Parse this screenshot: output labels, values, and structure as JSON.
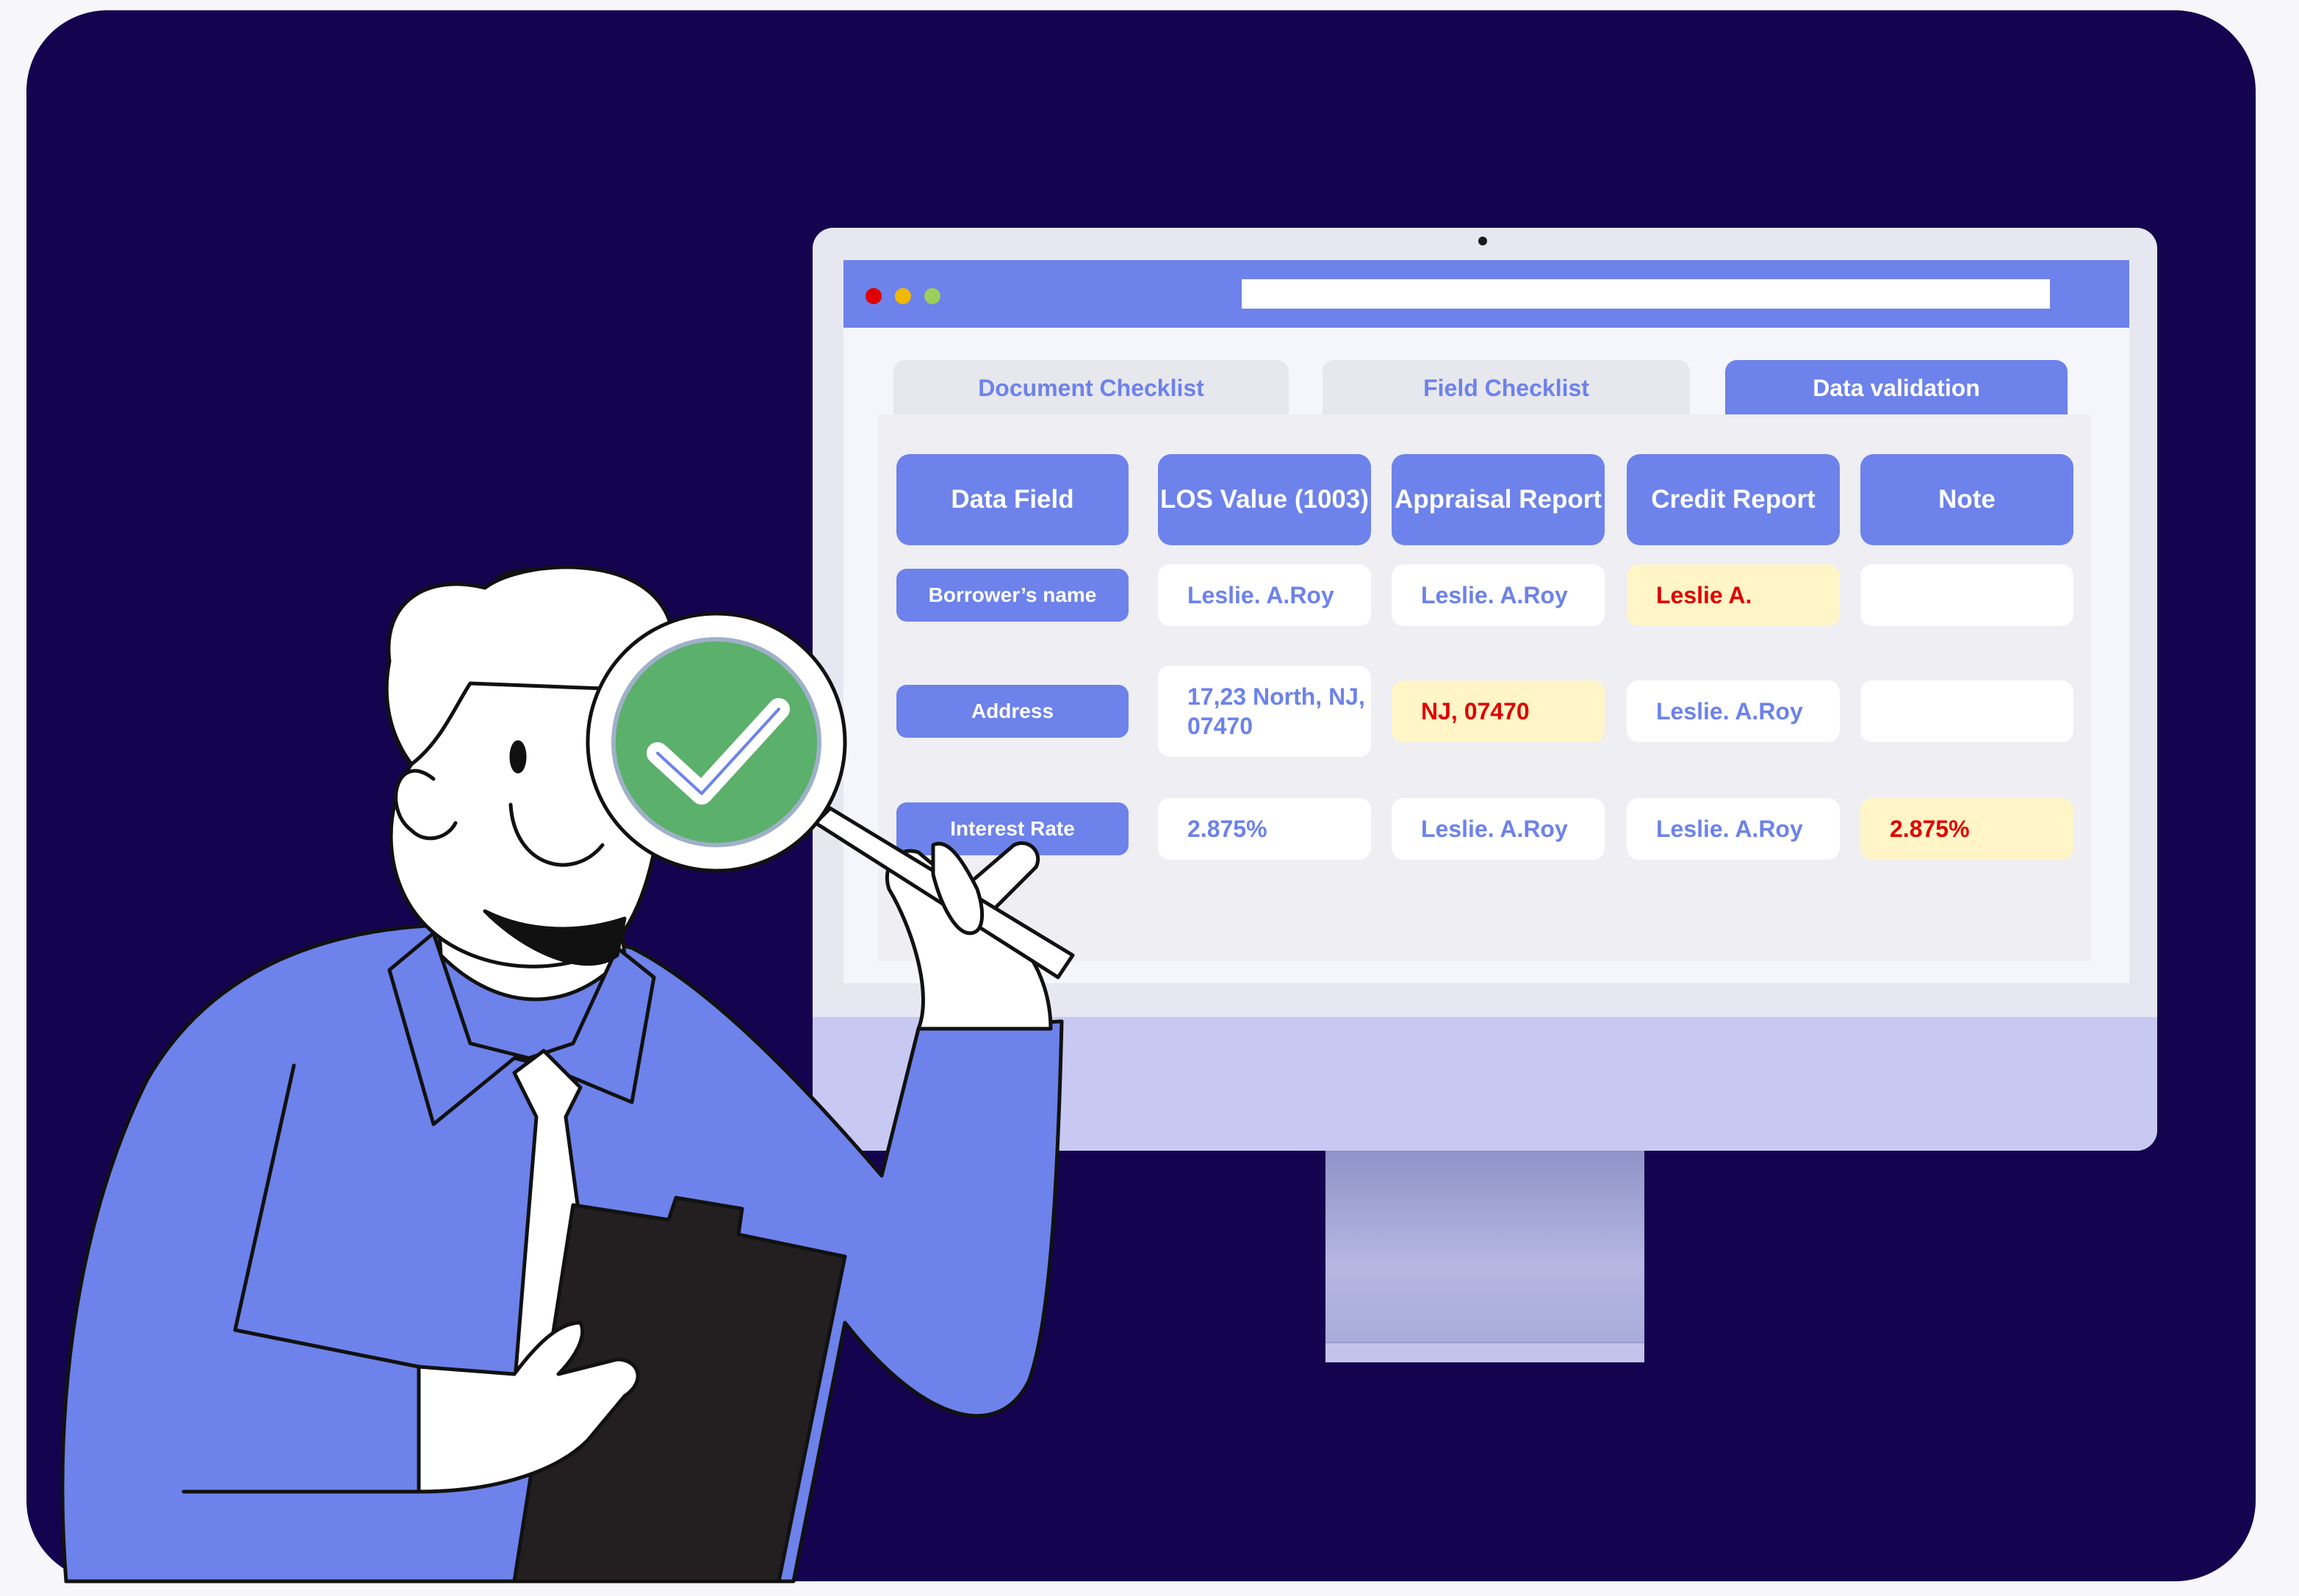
{
  "tabs": [
    {
      "label": "Document Checklist",
      "active": false
    },
    {
      "label": "Field Checklist",
      "active": false
    },
    {
      "label": "Data validation",
      "active": true
    }
  ],
  "table": {
    "headers": [
      "Data Field",
      "LOS Value (1003)",
      "Appraisal Report",
      "Credit Report",
      "Note"
    ],
    "rows": [
      {
        "label": "Borrower’s name",
        "cells": [
          {
            "text": "Leslie. A.Roy",
            "flagged": false
          },
          {
            "text": "Leslie. A.Roy",
            "flagged": false
          },
          {
            "text": "Leslie A.",
            "flagged": true
          },
          {
            "text": "",
            "flagged": false
          }
        ]
      },
      {
        "label": "Address",
        "cells": [
          {
            "text": "17,23 North, NJ, 07470",
            "flagged": false
          },
          {
            "text": "NJ, 07470",
            "flagged": true
          },
          {
            "text": "Leslie. A.Roy",
            "flagged": false
          },
          {
            "text": "",
            "flagged": false
          }
        ]
      },
      {
        "label": "Interest Rate",
        "cells": [
          {
            "text": "2.875%",
            "flagged": false
          },
          {
            "text": "Leslie. A.Roy",
            "flagged": false
          },
          {
            "text": "Leslie. A.Roy",
            "flagged": false
          },
          {
            "text": "2.875%",
            "flagged": true
          }
        ]
      }
    ]
  },
  "colors": {
    "background": "#14034f",
    "accent": "#6d82ea",
    "flag_bg": "#fff5c7",
    "flag_text": "#e00000",
    "check": "#5bb06b"
  },
  "icons": [
    "magnifier-icon",
    "checkmark-icon",
    "clipboard-icon"
  ]
}
